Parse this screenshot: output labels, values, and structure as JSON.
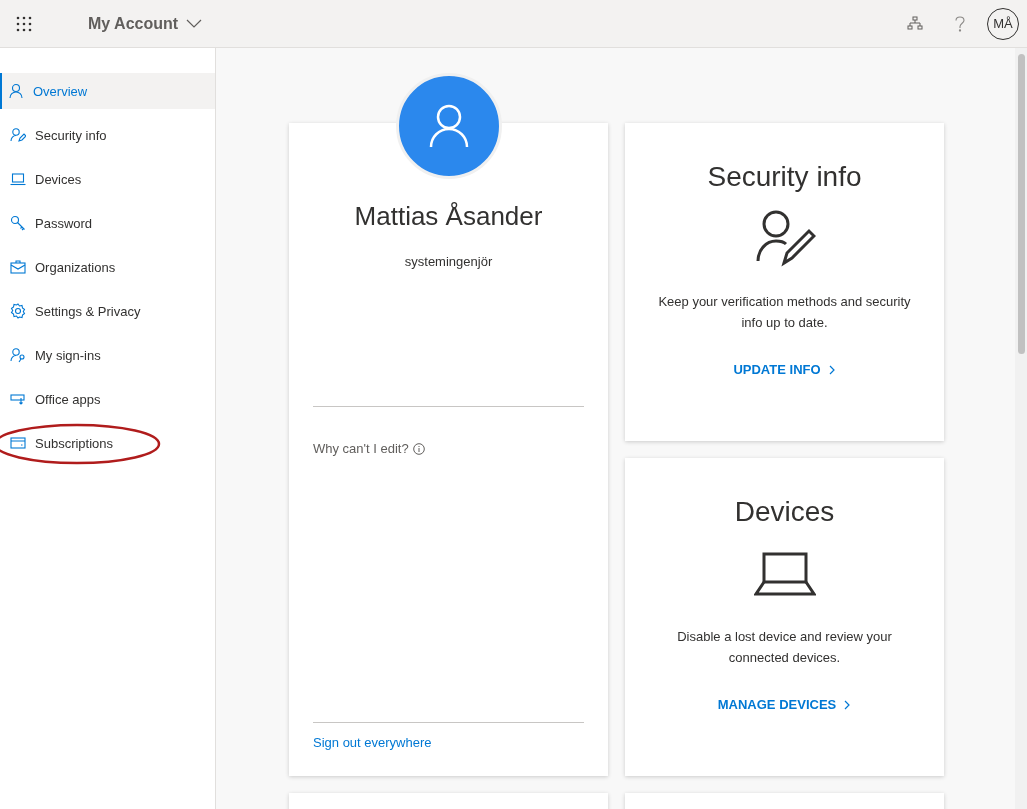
{
  "header": {
    "title": "My Account",
    "avatar_initials": "MÅ"
  },
  "sidebar": {
    "items": [
      {
        "label": "Overview",
        "selected": true
      },
      {
        "label": "Security info",
        "selected": false
      },
      {
        "label": "Devices",
        "selected": false
      },
      {
        "label": "Password",
        "selected": false
      },
      {
        "label": "Organizations",
        "selected": false
      },
      {
        "label": "Settings & Privacy",
        "selected": false
      },
      {
        "label": "My sign-ins",
        "selected": false
      },
      {
        "label": "Office apps",
        "selected": false
      },
      {
        "label": "Subscriptions",
        "selected": false
      }
    ]
  },
  "profile": {
    "name": "Mattias Åsander",
    "job_title": "systemingenjör",
    "edit_hint": "Why can't I edit?",
    "sign_out_link": "Sign out everywhere"
  },
  "cards": [
    {
      "title": "Security info",
      "description": "Keep your verification methods and security info up to date.",
      "action": "UPDATE INFO"
    },
    {
      "title": "Devices",
      "description": "Disable a lost device and review your connected devices.",
      "action": "MANAGE DEVICES"
    }
  ]
}
